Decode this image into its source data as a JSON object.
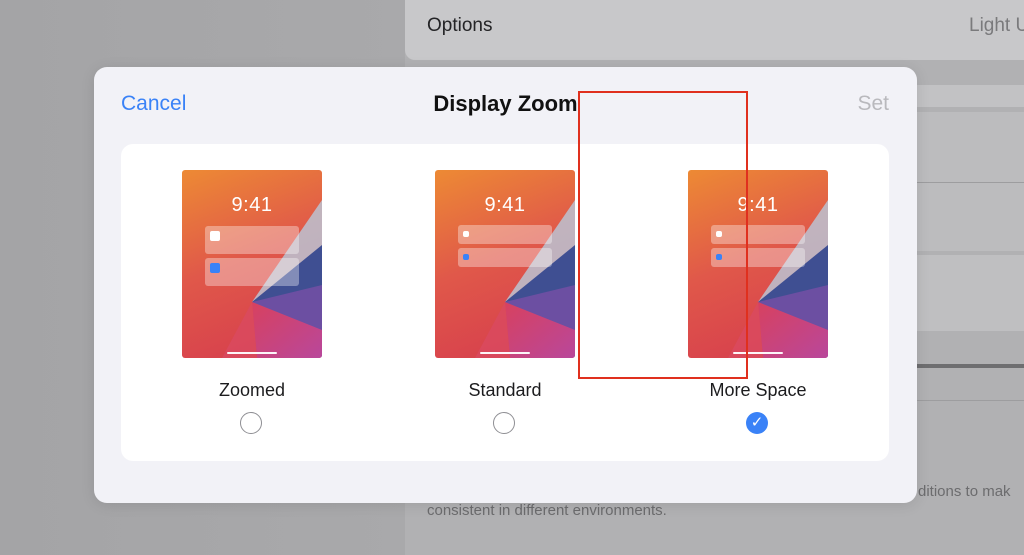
{
  "background": {
    "options_label": "Options",
    "options_value": "Light U",
    "footer_text_right": "ditions to mak",
    "footer_text_left": "consistent in different environments."
  },
  "modal": {
    "title": "Display Zoom",
    "cancel_label": "Cancel",
    "set_label": "Set",
    "options": [
      {
        "label": "Zoomed",
        "time": "9:41",
        "selected": false
      },
      {
        "label": "Standard",
        "time": "9:41",
        "selected": false
      },
      {
        "label": "More Space",
        "time": "9:41",
        "selected": true
      }
    ]
  },
  "colors": {
    "accent": "#3a82f7",
    "highlight": "#e0301e"
  }
}
